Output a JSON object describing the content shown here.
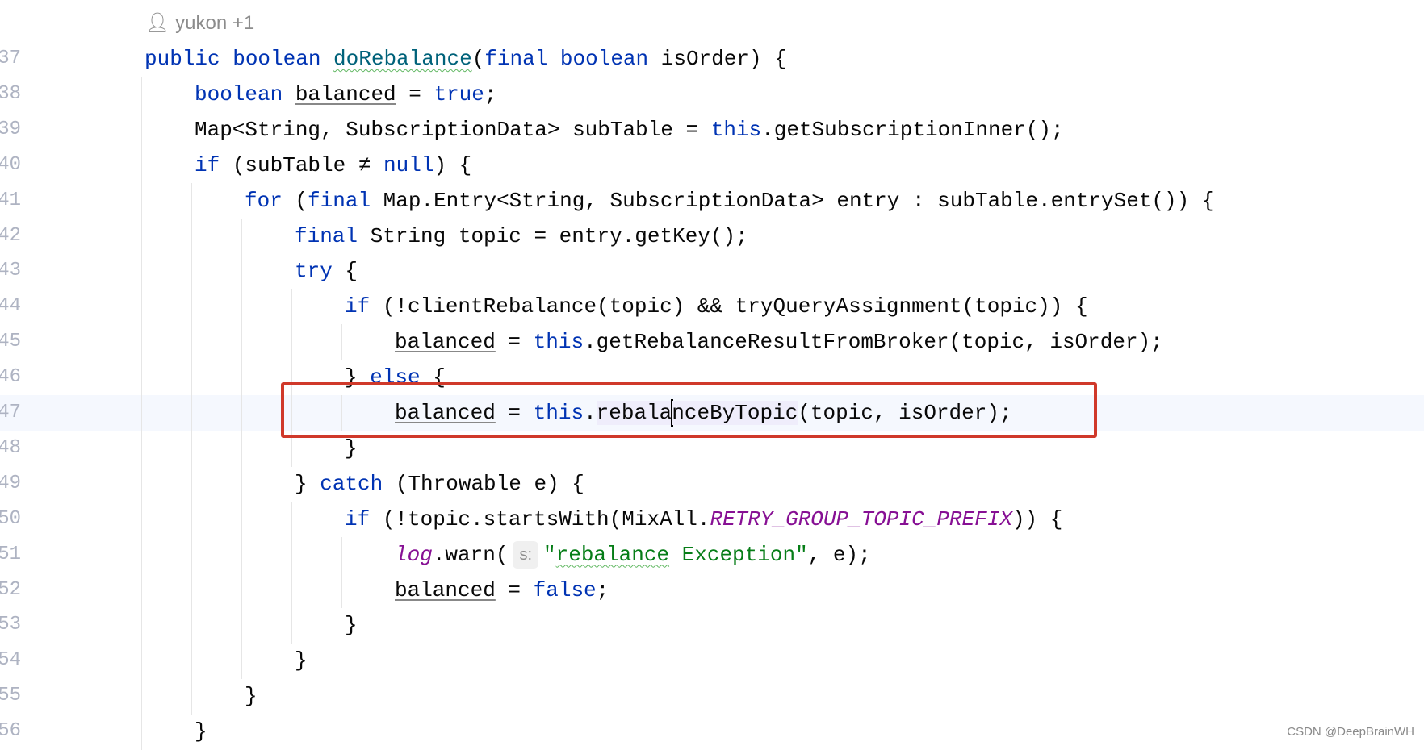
{
  "author_hint": {
    "icon": "person-icon",
    "text": "yukon +1"
  },
  "highlight_color": "#d0392a",
  "colors": {
    "keyword": "#0033b3",
    "method": "#00627a",
    "static_field": "#871094",
    "string": "#067d17"
  },
  "lines": [
    {
      "n": "37",
      "indent": 0,
      "tokens": [
        [
          "public boolean ",
          "k"
        ],
        [
          "doRebalance",
          "fn wv"
        ],
        [
          "(",
          ""
        ],
        [
          "final boolean ",
          "k"
        ],
        [
          "isOrder) {",
          ""
        ]
      ]
    },
    {
      "n": "38",
      "indent": 1,
      "tokens": [
        [
          "boolean ",
          "k"
        ],
        [
          "balanced",
          "v"
        ],
        [
          " = ",
          ""
        ],
        [
          "true",
          "k"
        ],
        [
          ";",
          ""
        ]
      ]
    },
    {
      "n": "39",
      "indent": 1,
      "tokens": [
        [
          "Map<String, SubscriptionData> subTable = ",
          ""
        ],
        [
          "this",
          "k"
        ],
        [
          ".getSubscriptionInner();",
          ""
        ]
      ]
    },
    {
      "n": "40",
      "indent": 1,
      "tokens": [
        [
          "if ",
          "k"
        ],
        [
          "(subTable ≠ ",
          ""
        ],
        [
          "null",
          "k"
        ],
        [
          ") {",
          ""
        ]
      ]
    },
    {
      "n": "41",
      "indent": 2,
      "tokens": [
        [
          "for ",
          "k"
        ],
        [
          "(",
          ""
        ],
        [
          "final ",
          "k"
        ],
        [
          "Map.Entry<String, SubscriptionData> entry : subTable.entrySet()) {",
          ""
        ]
      ]
    },
    {
      "n": "42",
      "indent": 3,
      "tokens": [
        [
          "final ",
          "k"
        ],
        [
          "String topic = entry.getKey();",
          ""
        ]
      ]
    },
    {
      "n": "43",
      "indent": 3,
      "tokens": [
        [
          "try ",
          "k"
        ],
        [
          "{",
          ""
        ]
      ]
    },
    {
      "n": "44",
      "indent": 4,
      "tokens": [
        [
          "if ",
          "k"
        ],
        [
          "(!clientRebalance(topic) && tryQueryAssignment(topic)) {",
          ""
        ]
      ]
    },
    {
      "n": "45",
      "indent": 5,
      "tokens": [
        [
          "balanced",
          "v"
        ],
        [
          " = ",
          ""
        ],
        [
          "this",
          "k"
        ],
        [
          ".getRebalanceResultFromBroker(topic, isOrder);",
          ""
        ]
      ]
    },
    {
      "n": "46",
      "indent": 4,
      "tokens": [
        [
          "} ",
          ""
        ],
        [
          "else ",
          "k"
        ],
        [
          "{",
          ""
        ]
      ]
    },
    {
      "n": "47",
      "indent": 5,
      "tokens": [
        [
          "balanced",
          "v"
        ],
        [
          " = ",
          ""
        ],
        [
          "this",
          "k"
        ],
        [
          ".",
          ""
        ],
        [
          "rebala",
          "sel"
        ],
        [
          "",
          "caret"
        ],
        [
          "nceByTopic",
          "sel"
        ],
        [
          "(topic, isOrder);",
          ""
        ]
      ]
    },
    {
      "n": "48",
      "indent": 4,
      "tokens": [
        [
          "}",
          ""
        ]
      ]
    },
    {
      "n": "49",
      "indent": 3,
      "tokens": [
        [
          "} ",
          ""
        ],
        [
          "catch ",
          "k"
        ],
        [
          "(Throwable e) {",
          ""
        ]
      ]
    },
    {
      "n": "50",
      "indent": 4,
      "tokens": [
        [
          "if ",
          "k"
        ],
        [
          "(!topic.startsWith(MixAll.",
          ""
        ],
        [
          "RETRY_GROUP_TOPIC_PREFIX",
          "st"
        ],
        [
          ")) {",
          ""
        ]
      ]
    },
    {
      "n": "51",
      "indent": 5,
      "tokens": [
        [
          "log",
          "st"
        ],
        [
          ".warn(",
          ""
        ],
        [
          "s:",
          "hint"
        ],
        [
          "\"",
          "s"
        ],
        [
          "rebalance",
          "s wv"
        ],
        [
          " Exception\"",
          "s"
        ],
        [
          ", e);",
          ""
        ]
      ]
    },
    {
      "n": "52",
      "indent": 5,
      "tokens": [
        [
          "balanced",
          "v"
        ],
        [
          " = ",
          ""
        ],
        [
          "false",
          "k"
        ],
        [
          ";",
          ""
        ]
      ]
    },
    {
      "n": "53",
      "indent": 4,
      "tokens": [
        [
          "}",
          ""
        ]
      ]
    },
    {
      "n": "54",
      "indent": 3,
      "tokens": [
        [
          "}",
          ""
        ]
      ]
    },
    {
      "n": "55",
      "indent": 2,
      "tokens": [
        [
          "}",
          ""
        ]
      ]
    },
    {
      "n": "56",
      "indent": 1,
      "tokens": [
        [
          "}",
          ""
        ]
      ]
    }
  ],
  "watermark": "CSDN @DeepBrainWH"
}
